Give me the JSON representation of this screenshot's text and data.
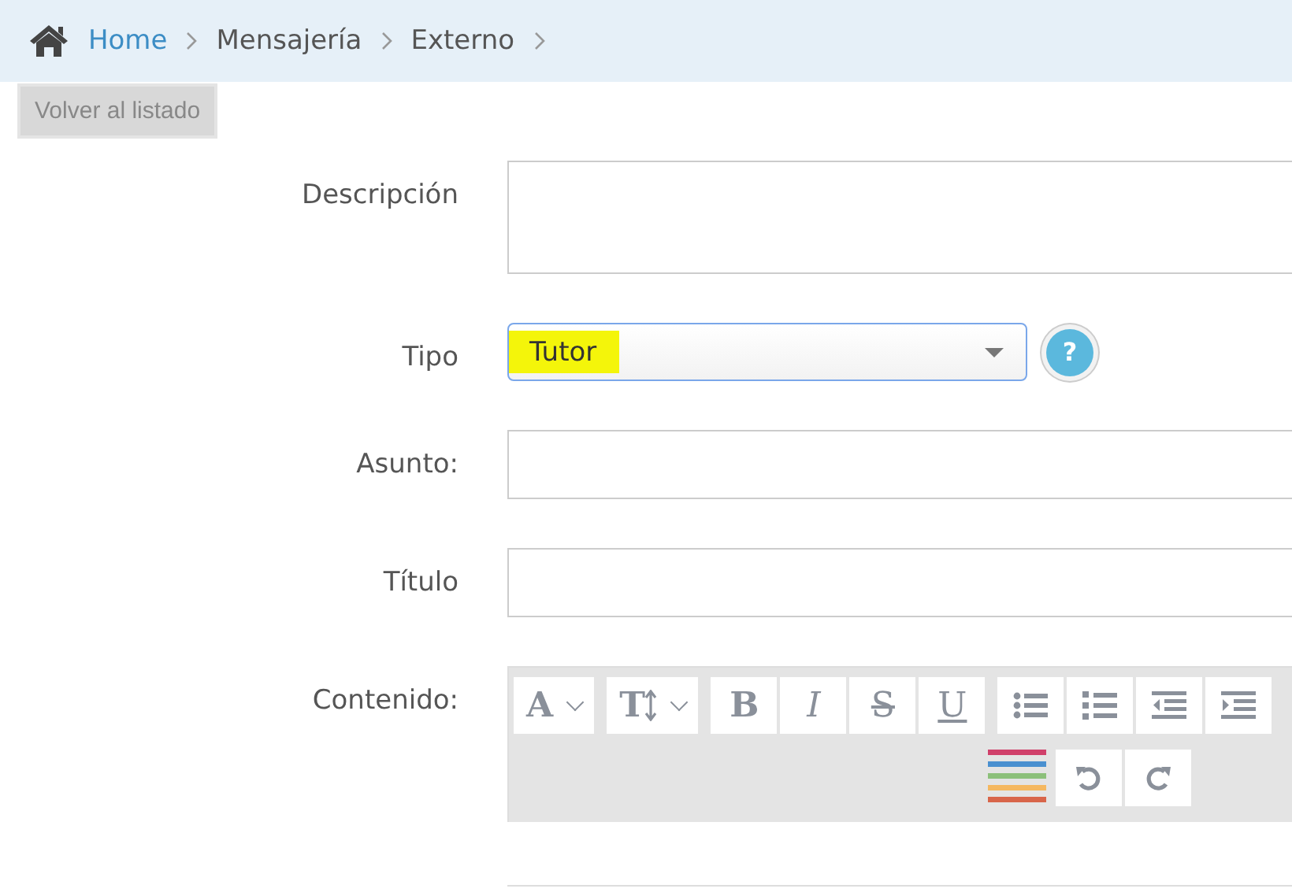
{
  "breadcrumb": [
    {
      "label": "Home",
      "kind": "link"
    },
    {
      "label": "Mensajería",
      "kind": "text"
    },
    {
      "label": "Externo",
      "kind": "text"
    }
  ],
  "back_button": "Volver al listado",
  "form": [
    {
      "label": "Descripción",
      "kind": "textarea"
    },
    {
      "label": "Tipo",
      "kind": "select",
      "value": "Tutor",
      "highlighted": true,
      "help": "?"
    },
    {
      "label": "Asunto:",
      "kind": "input"
    },
    {
      "label": "Título",
      "kind": "input"
    },
    {
      "label": "Contenido:",
      "kind": "editor"
    }
  ],
  "editor_rows": [
    {
      "groups": [
        [
          {
            "kind": "font",
            "label": "A"
          }
        ],
        [
          {
            "kind": "size",
            "label": "T"
          }
        ],
        [
          {
            "kind": "bold",
            "label": "B"
          },
          {
            "kind": "italic",
            "label": "I"
          },
          {
            "kind": "strike",
            "label": "S"
          },
          {
            "kind": "underline",
            "label": "U"
          }
        ],
        [
          {
            "kind": "bullets"
          },
          {
            "kind": "numbers"
          },
          {
            "kind": "outdent"
          },
          {
            "kind": "indent"
          }
        ]
      ]
    },
    {
      "groups": [
        [
          {
            "kind": "colors"
          }
        ],
        [
          {
            "kind": "undo"
          },
          {
            "kind": "redo"
          }
        ]
      ]
    }
  ]
}
